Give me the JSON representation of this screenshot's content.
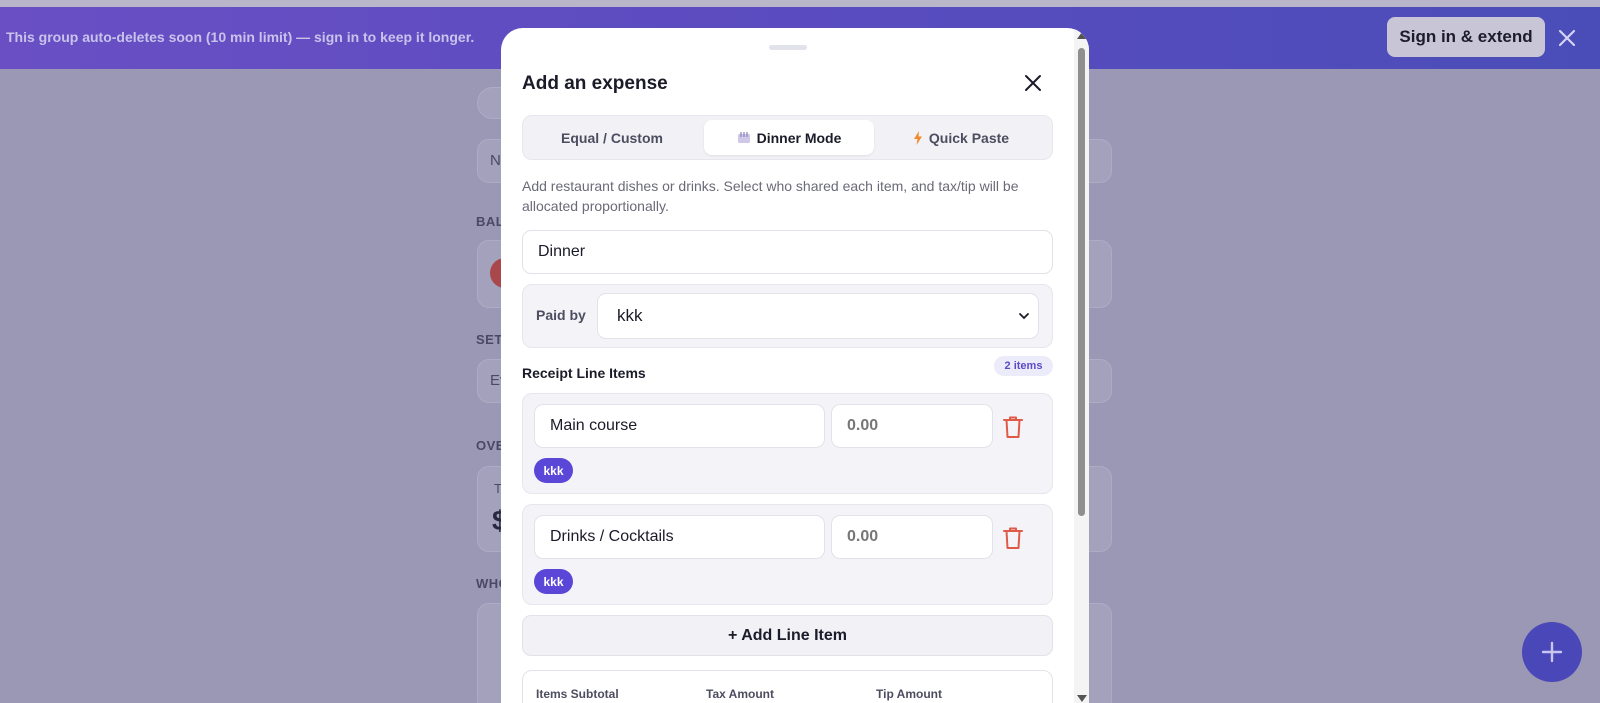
{
  "banner": {
    "message": "This group auto-deletes soon (10 min limit) — sign in to keep it longer.",
    "action_label": "Sign in & extend"
  },
  "background": {
    "input_fragment_1": "N",
    "label_fragment_1": "BAL",
    "label_fragment_2": "SET",
    "input_fragment_2": "Ev",
    "label_fragment_3": "OVE",
    "card_fragment": "T",
    "dollar_fragment": "$",
    "label_fragment_4": "WHO"
  },
  "modal": {
    "title": "Add an expense",
    "tabs": [
      {
        "label": "Equal / Custom",
        "icon": "",
        "active": false
      },
      {
        "label": "Dinner Mode",
        "icon": "dinner-icon",
        "active": true
      },
      {
        "label": "Quick Paste",
        "icon": "lightning-icon",
        "active": false
      }
    ],
    "description": "Add restaurant dishes or drinks. Select who shared each item, and tax/tip will be allocated proportionally.",
    "expense_name": "Dinner",
    "paid_by_label": "Paid by",
    "paid_by_value": "kkk",
    "section_title": "Receipt Line Items",
    "item_count": "2 items",
    "line_items": [
      {
        "name": "Main course",
        "amount": "0.00",
        "member": "kkk"
      },
      {
        "name": "Drinks / Cocktails",
        "amount": "0.00",
        "member": "kkk"
      }
    ],
    "add_line_label": "+ Add Line Item",
    "totals": {
      "subtotal_label": "Items Subtotal",
      "tax_label": "Tax Amount",
      "tip_label": "Tip Amount"
    }
  },
  "colors": {
    "banner": "#5a4cc0",
    "accent": "#5a47d8",
    "danger": "#e05a4a",
    "fab": "#4a47b8"
  }
}
